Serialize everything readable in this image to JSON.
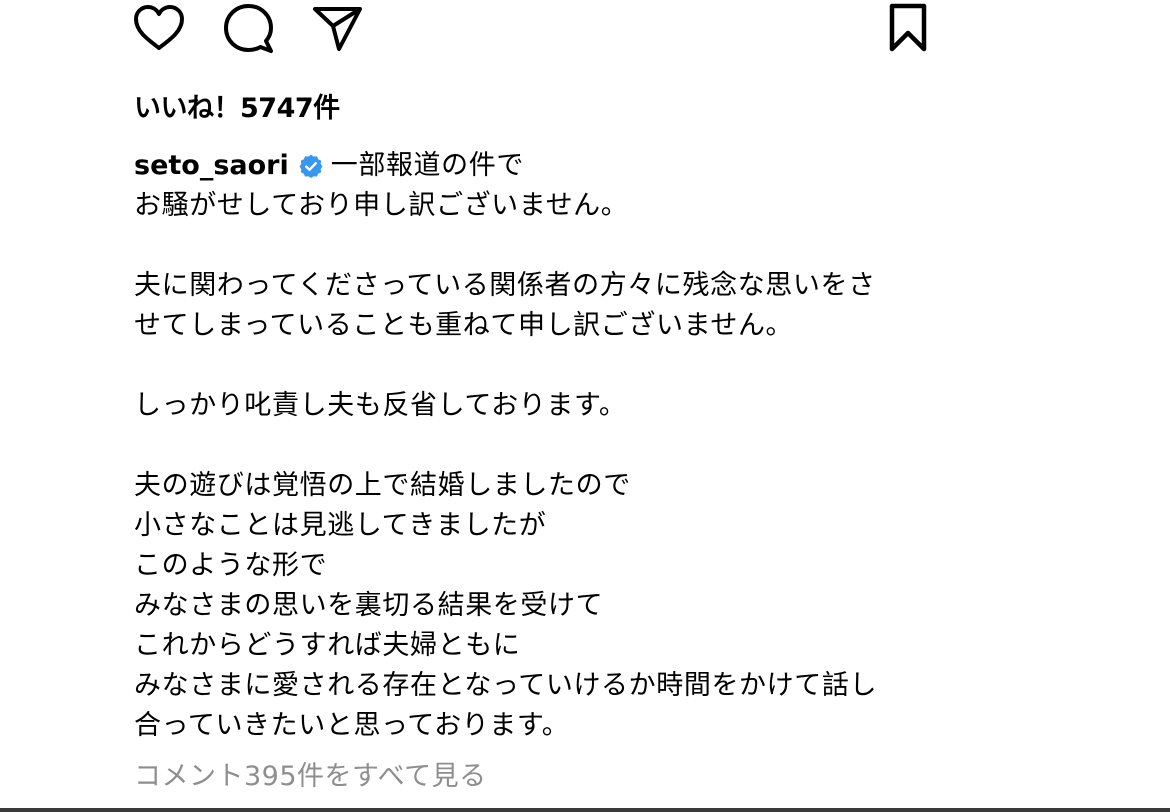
{
  "post": {
    "actions": {
      "like_icon": "heart-outline",
      "comment_icon": "speech-bubble-outline",
      "share_icon": "paper-plane-outline",
      "save_icon": "bookmark-outline"
    },
    "likes_text": "いいね！5747件",
    "caption": {
      "username": "seto_saori",
      "verified": true,
      "verified_color": "#3897f0",
      "first_line": "一部報道の件で",
      "lines": [
        "お騒がせしており申し訳ございません。",
        "",
        "夫に関わってくださっている関係者の方々に残念な思いをさ",
        "せてしまっていることも重ねて申し訳ございません。",
        "",
        "しっかり叱責し夫も反省しております。",
        "",
        "夫の遊びは覚悟の上で結婚しましたので",
        "小さなことは見逃してきましたが",
        "このような形で",
        "みなさまの思いを裏切る結果を受けて",
        "これからどうすれば夫婦ともに",
        "みなさまに愛される存在となっていけるか時間をかけて話し",
        "合っていきたいと思っております。"
      ]
    },
    "view_comments": "コメント395件をすべて見る"
  }
}
